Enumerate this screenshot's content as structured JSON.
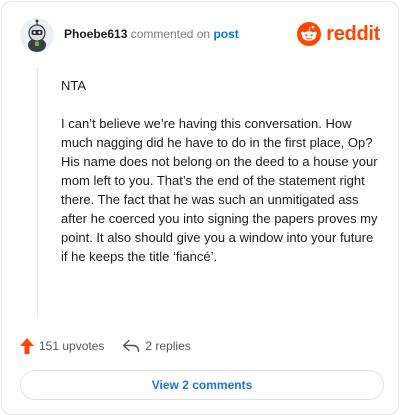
{
  "header": {
    "username": "Phoebe613",
    "action_text": "commented on",
    "post_link": "post",
    "brand": "reddit"
  },
  "comment": {
    "paragraphs": [
      "NTA",
      "I can’t believe we’re having this conversation. How much nagging did he have to do in the first place, Op? His name does not belong on the deed to a house your mom left to you. That’s the end of the statement right there. The fact that he was such an unmitigated ass after he coerced you into signing the papers proves my point. It also should give you a window into your future if he keeps the title ‘fiancé’."
    ]
  },
  "actions": {
    "upvotes": "151 upvotes",
    "replies": "2 replies"
  },
  "view_comments_label": "View 2 comments",
  "colors": {
    "brand": "#ff4500",
    "link": "#0079d3",
    "button_text": "#1a73e8"
  },
  "icons": [
    "avatar-icon",
    "reddit-snoo-icon",
    "upvote-arrow-icon",
    "reply-icon"
  ]
}
